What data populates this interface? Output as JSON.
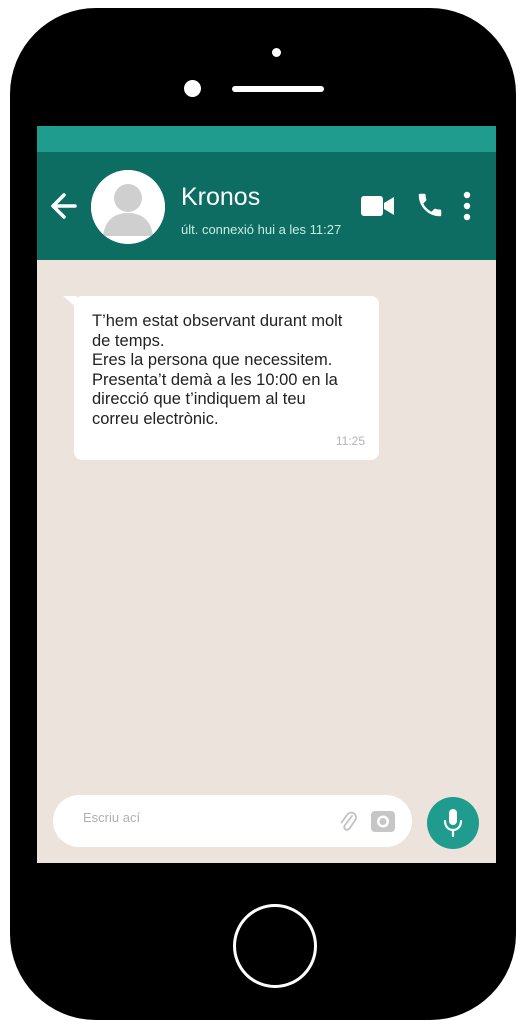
{
  "colors": {
    "header": "#0d6d62",
    "status_bar": "#1f9c8e",
    "chat_background": "#ebe3dc",
    "bubble": "#ffffff",
    "accent": "#1f9c8e"
  },
  "icons": {
    "back": "arrow-left-icon",
    "avatar": "default-avatar-icon",
    "video": "video-camera-icon",
    "call": "phone-icon",
    "menu": "more-vertical-icon",
    "attach": "paperclip-icon",
    "camera": "camera-icon",
    "mic": "microphone-icon"
  },
  "header": {
    "contact_name": "Kronos",
    "last_seen": "últ. connexió hui a les 11:27"
  },
  "message": {
    "text": "T’hem estat observant durant molt\nde temps.\nEres la persona que necessitem.\nPresenta’t demà a les 10:00 en la\ndirecció que t’indiquem al teu\ncorreu electrònic.",
    "time": "11:25"
  },
  "composer": {
    "placeholder": "Escriu ací",
    "value": ""
  }
}
